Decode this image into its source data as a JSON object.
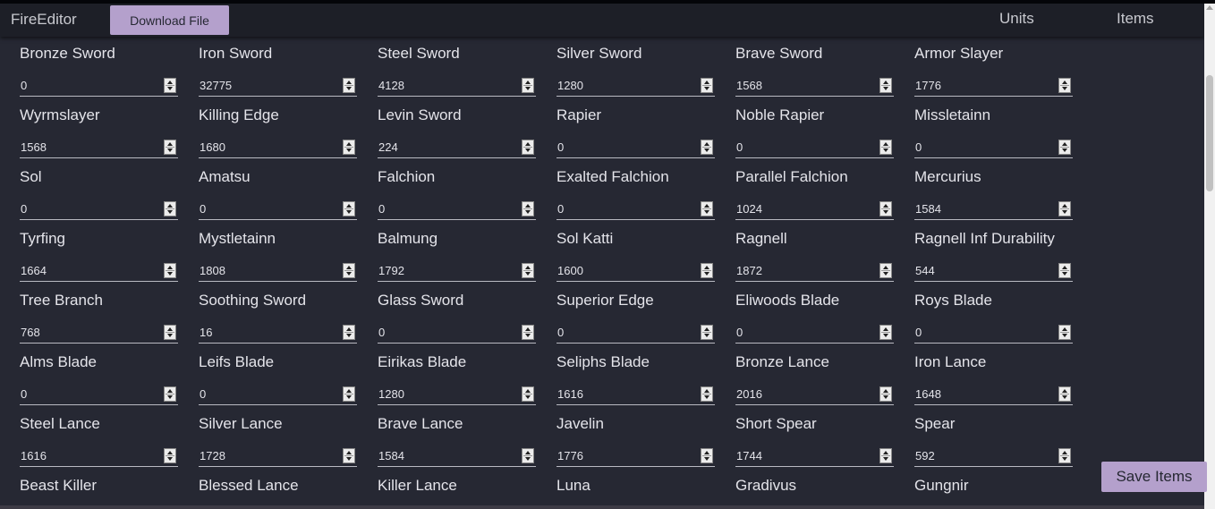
{
  "nav": {
    "brand": "FireEditor",
    "download_label": "Download File",
    "links": [
      "Units",
      "Items"
    ]
  },
  "items": [
    {
      "name": "Bronze Sword",
      "value": "0"
    },
    {
      "name": "Iron Sword",
      "value": "32775"
    },
    {
      "name": "Steel Sword",
      "value": "4128"
    },
    {
      "name": "Silver Sword",
      "value": "1280"
    },
    {
      "name": "Brave Sword",
      "value": "1568"
    },
    {
      "name": "Armor Slayer",
      "value": "1776"
    },
    {
      "name": "Wyrmslayer",
      "value": "1568"
    },
    {
      "name": "Killing Edge",
      "value": "1680"
    },
    {
      "name": "Levin Sword",
      "value": "224"
    },
    {
      "name": "Rapier",
      "value": "0"
    },
    {
      "name": "Noble Rapier",
      "value": "0"
    },
    {
      "name": "Missletainn",
      "value": "0"
    },
    {
      "name": "Sol",
      "value": "0"
    },
    {
      "name": "Amatsu",
      "value": "0"
    },
    {
      "name": "Falchion",
      "value": "0"
    },
    {
      "name": "Exalted Falchion",
      "value": "0"
    },
    {
      "name": "Parallel Falchion",
      "value": "1024"
    },
    {
      "name": "Mercurius",
      "value": "1584"
    },
    {
      "name": "Tyrfing",
      "value": "1664"
    },
    {
      "name": "Mystletainn",
      "value": "1808"
    },
    {
      "name": "Balmung",
      "value": "1792"
    },
    {
      "name": "Sol Katti",
      "value": "1600"
    },
    {
      "name": "Ragnell",
      "value": "1872"
    },
    {
      "name": "Ragnell Inf Durability",
      "value": "544"
    },
    {
      "name": "Tree Branch",
      "value": "768"
    },
    {
      "name": "Soothing Sword",
      "value": "16"
    },
    {
      "name": "Glass Sword",
      "value": "0"
    },
    {
      "name": "Superior Edge",
      "value": "0"
    },
    {
      "name": "Eliwoods Blade",
      "value": "0"
    },
    {
      "name": "Roys Blade",
      "value": "0"
    },
    {
      "name": "Alms Blade",
      "value": "0"
    },
    {
      "name": "Leifs Blade",
      "value": "0"
    },
    {
      "name": "Eirikas Blade",
      "value": "1280"
    },
    {
      "name": "Seliphs Blade",
      "value": "1616"
    },
    {
      "name": "Bronze Lance",
      "value": "2016"
    },
    {
      "name": "Iron Lance",
      "value": "1648"
    },
    {
      "name": "Steel Lance",
      "value": "1616"
    },
    {
      "name": "Silver Lance",
      "value": "1728"
    },
    {
      "name": "Brave Lance",
      "value": "1584"
    },
    {
      "name": "Javelin",
      "value": "1776"
    },
    {
      "name": "Short Spear",
      "value": "1744"
    },
    {
      "name": "Spear",
      "value": "592"
    },
    {
      "name": "Beast Killer",
      "value": ""
    },
    {
      "name": "Blessed Lance",
      "value": ""
    },
    {
      "name": "Killer Lance",
      "value": ""
    },
    {
      "name": "Luna",
      "value": ""
    },
    {
      "name": "Gradivus",
      "value": ""
    },
    {
      "name": "Gungnir",
      "value": ""
    }
  ],
  "save_label": "Save Items"
}
